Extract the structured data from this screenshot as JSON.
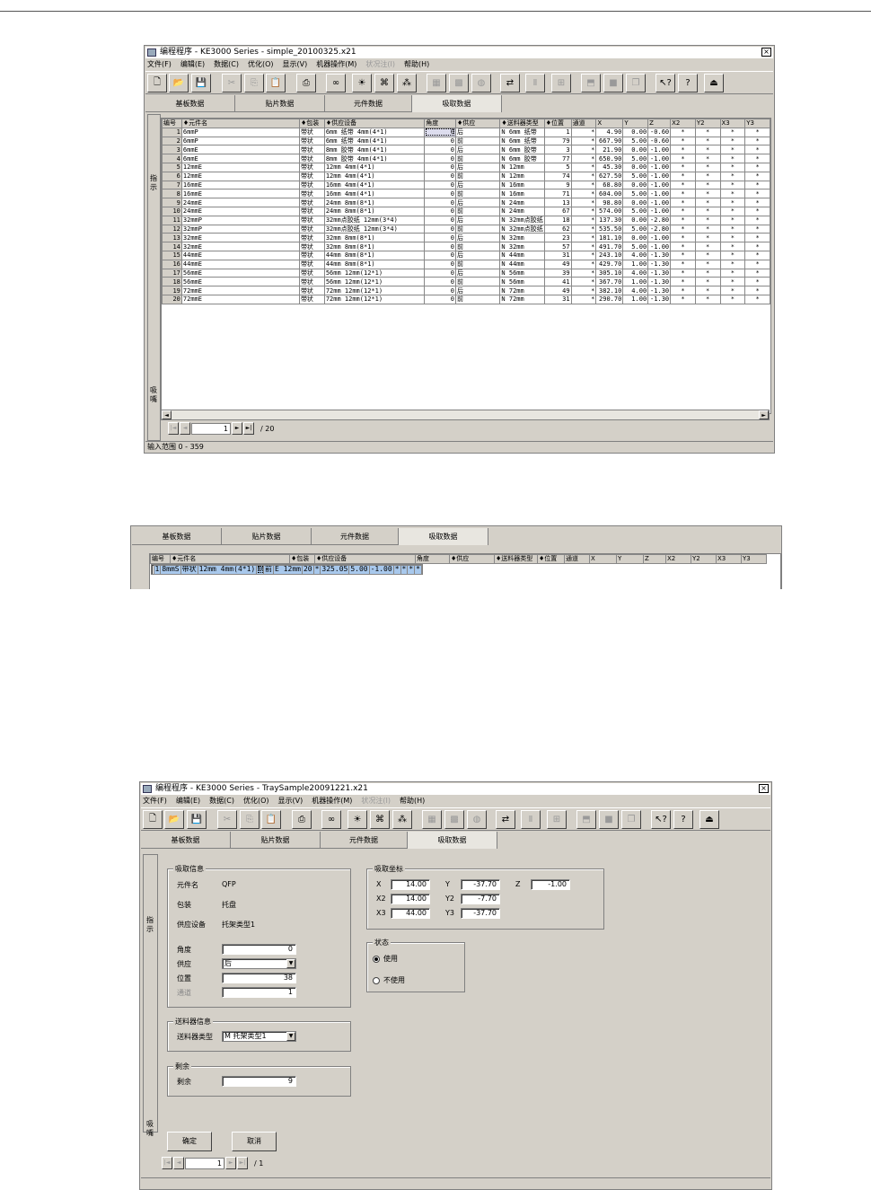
{
  "win1": {
    "title": "编程程序 - KE3000 Series - simple_20100325.x21",
    "close": "×",
    "menus": [
      {
        "label": "文件(F)",
        "enabled": true
      },
      {
        "label": "编辑(E)",
        "enabled": true
      },
      {
        "label": "数据(C)",
        "enabled": true
      },
      {
        "label": "优化(O)",
        "enabled": true
      },
      {
        "label": "显示(V)",
        "enabled": true
      },
      {
        "label": "机器操作(M)",
        "enabled": true
      },
      {
        "label": "状况注(I)",
        "enabled": false
      },
      {
        "label": "帮助(H)",
        "enabled": true
      }
    ],
    "tabs": [
      "基板数据",
      "贴片数据",
      "元件数据",
      "吸取数据"
    ],
    "side_labels": [
      "指示",
      "吸嘴"
    ],
    "headers": [
      "编号",
      "♦元件名",
      "♦包装",
      "♦供应设备",
      "角度",
      "♦供应",
      "♦送料器类型",
      "♦位置",
      "通道",
      "X",
      "Y",
      "Z",
      "X2",
      "Y2",
      "X3",
      "Y3"
    ],
    "rows": [
      [
        "1",
        "6mmP",
        "带状",
        "6mm 纸带 4mm(4*1)",
        "0",
        "后",
        "N 6mm 纸带",
        "1",
        "*",
        "4.90",
        "0.00",
        "-0.60",
        "*",
        "*",
        "*",
        "*"
      ],
      [
        "2",
        "6mmP",
        "带状",
        "6mm 纸带 4mm(4*1)",
        "0",
        "前",
        "N 6mm 纸带",
        "79",
        "*",
        "667.90",
        "5.00",
        "-0.60",
        "*",
        "*",
        "*",
        "*"
      ],
      [
        "3",
        "6mmE",
        "带状",
        "8mm 胶带 4mm(4*1)",
        "0",
        "后",
        "N 6mm 胶带",
        "3",
        "*",
        "21.90",
        "0.00",
        "-1.00",
        "*",
        "*",
        "*",
        "*"
      ],
      [
        "4",
        "6mmE",
        "带状",
        "8mm 胶带 4mm(4*1)",
        "0",
        "前",
        "N 6mm 胶带",
        "77",
        "*",
        "650.90",
        "5.00",
        "-1.00",
        "*",
        "*",
        "*",
        "*"
      ],
      [
        "5",
        "12mmE",
        "带状",
        "12mm 4mm(4*1)",
        "0",
        "后",
        "N 12mm",
        "5",
        "*",
        "45.30",
        "0.00",
        "-1.00",
        "*",
        "*",
        "*",
        "*"
      ],
      [
        "6",
        "12mmE",
        "带状",
        "12mm 4mm(4*1)",
        "0",
        "前",
        "N 12mm",
        "74",
        "*",
        "627.50",
        "5.00",
        "-1.00",
        "*",
        "*",
        "*",
        "*"
      ],
      [
        "7",
        "16mmE",
        "带状",
        "16mm 4mm(4*1)",
        "0",
        "后",
        "N 16mm",
        "9",
        "*",
        "68.80",
        "0.00",
        "-1.00",
        "*",
        "*",
        "*",
        "*"
      ],
      [
        "8",
        "16mmE",
        "带状",
        "16mm 4mm(4*1)",
        "0",
        "前",
        "N 16mm",
        "71",
        "*",
        "604.00",
        "5.00",
        "-1.00",
        "*",
        "*",
        "*",
        "*"
      ],
      [
        "9",
        "24mmE",
        "带状",
        "24mm 8mm(8*1)",
        "0",
        "后",
        "N 24mm",
        "13",
        "*",
        "98.80",
        "0.00",
        "-1.00",
        "*",
        "*",
        "*",
        "*"
      ],
      [
        "10",
        "24mmE",
        "带状",
        "24mm 8mm(8*1)",
        "0",
        "前",
        "N 24mm",
        "67",
        "*",
        "574.00",
        "5.00",
        "-1.00",
        "*",
        "*",
        "*",
        "*"
      ],
      [
        "11",
        "32mmP",
        "带状",
        "32mm点胶纸 12mm(3*4)",
        "0",
        "后",
        "N 32mm点胶纸",
        "18",
        "*",
        "137.30",
        "0.00",
        "-2.80",
        "*",
        "*",
        "*",
        "*"
      ],
      [
        "12",
        "32mmP",
        "带状",
        "32mm点胶纸 12mm(3*4)",
        "0",
        "前",
        "N 32mm点胶纸",
        "62",
        "*",
        "535.50",
        "5.00",
        "-2.80",
        "*",
        "*",
        "*",
        "*"
      ],
      [
        "13",
        "32mmE",
        "带状",
        "32mm 8mm(8*1)",
        "0",
        "后",
        "N 32mm",
        "23",
        "*",
        "181.10",
        "0.00",
        "-1.00",
        "*",
        "*",
        "*",
        "*"
      ],
      [
        "14",
        "32mmE",
        "带状",
        "32mm 8mm(8*1)",
        "0",
        "前",
        "N 32mm",
        "57",
        "*",
        "491.70",
        "5.00",
        "-1.00",
        "*",
        "*",
        "*",
        "*"
      ],
      [
        "15",
        "44mmE",
        "带状",
        "44mm 8mm(8*1)",
        "0",
        "后",
        "N 44mm",
        "31",
        "*",
        "243.10",
        "4.00",
        "-1.30",
        "*",
        "*",
        "*",
        "*"
      ],
      [
        "16",
        "44mmE",
        "带状",
        "44mm 8mm(8*1)",
        "0",
        "前",
        "N 44mm",
        "49",
        "*",
        "429.70",
        "1.00",
        "-1.30",
        "*",
        "*",
        "*",
        "*"
      ],
      [
        "17",
        "56mmE",
        "带状",
        "56mm 12mm(12*1)",
        "0",
        "后",
        "N 56mm",
        "39",
        "*",
        "305.10",
        "4.00",
        "-1.30",
        "*",
        "*",
        "*",
        "*"
      ],
      [
        "18",
        "56mmE",
        "带状",
        "56mm 12mm(12*1)",
        "0",
        "前",
        "N 56mm",
        "41",
        "*",
        "367.70",
        "1.00",
        "-1.30",
        "*",
        "*",
        "*",
        "*"
      ],
      [
        "19",
        "72mmE",
        "带状",
        "72mm 12mm(12*1)",
        "0",
        "后",
        "N 72mm",
        "49",
        "*",
        "382.10",
        "4.00",
        "-1.30",
        "*",
        "*",
        "*",
        "*"
      ],
      [
        "20",
        "72mmE",
        "带状",
        "72mm 12mm(12*1)",
        "0",
        "前",
        "N 72mm",
        "31",
        "*",
        "290.70",
        "1.00",
        "-1.30",
        "*",
        "*",
        "*",
        "*"
      ]
    ],
    "page_value": "1",
    "page_total": "/ 20",
    "status": "输入范围 0 - 359"
  },
  "win2": {
    "tabs": [
      "基板数据",
      "贴片数据",
      "元件数据",
      "吸取数据"
    ],
    "headers": [
      "编号",
      "♦元件名",
      "♦包装",
      "♦供应设备",
      "角度",
      "♦供应",
      "♦送料器类型",
      "♦位置",
      "通道",
      "X",
      "Y",
      "Z",
      "X2",
      "Y2",
      "X3",
      "Y3"
    ],
    "row": [
      "1",
      "8mmS",
      "带状",
      "12mm 4mm(4*1)",
      "0",
      "前",
      "E 12mm",
      "20",
      "*",
      "325.05",
      "5.00",
      "-1.00",
      "*",
      "*",
      "*",
      "*"
    ]
  },
  "win3": {
    "title": "编程程序 - KE3000 Series - TraySample20091221.x21",
    "close": "×",
    "menus": [
      {
        "label": "文件(F)",
        "enabled": true
      },
      {
        "label": "编辑(E)",
        "enabled": true
      },
      {
        "label": "数据(C)",
        "enabled": true
      },
      {
        "label": "优化(O)",
        "enabled": true
      },
      {
        "label": "显示(V)",
        "enabled": true
      },
      {
        "label": "机器操作(M)",
        "enabled": true
      },
      {
        "label": "状况注(I)",
        "enabled": false
      },
      {
        "label": "帮助(H)",
        "enabled": true
      }
    ],
    "tabs": [
      "基板数据",
      "贴片数据",
      "元件数据",
      "吸取数据"
    ],
    "side_labels": [
      "指示",
      "吸嘴"
    ],
    "pick_info": {
      "title": "吸取信息",
      "part_label": "元件名",
      "part_value": "QFP",
      "pkg_label": "包装",
      "pkg_value": "托盘",
      "supply_label": "供应设备",
      "supply_value": "托架类型1",
      "angle_label": "角度",
      "angle_value": "0",
      "feed_label": "供应",
      "feed_value": "后",
      "pos_label": "位置",
      "pos_value": "38",
      "chan_label": "通道",
      "chan_value": "1"
    },
    "feeder_info": {
      "title": "送料器信息",
      "type_label": "送料器类型",
      "type_value": "M 托架类型1"
    },
    "remain": {
      "title": "剩余",
      "label": "剩余",
      "value": "9"
    },
    "coords": {
      "title": "吸取坐标",
      "x_label": "X",
      "x_value": "14.00",
      "y_label": "Y",
      "y_value": "-37.70",
      "z_label": "Z",
      "z_value": "-1.00",
      "x2_label": "X2",
      "x2_value": "14.00",
      "y2_label": "Y2",
      "y2_value": "-7.70",
      "x3_label": "X3",
      "x3_value": "44.00",
      "y3_label": "Y3",
      "y3_value": "-37.70"
    },
    "state": {
      "title": "状态",
      "use": "使用",
      "nouse": "不使用",
      "selected": "use"
    },
    "ok": "确定",
    "cancel": "取消",
    "page_value": "1",
    "page_total": "/ 1"
  }
}
